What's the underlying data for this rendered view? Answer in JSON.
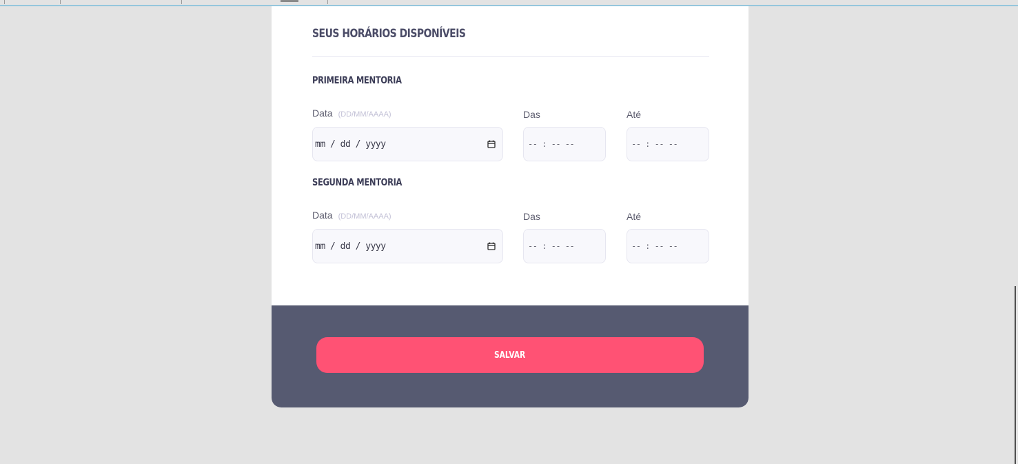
{
  "form": {
    "title": "SEUS HORÁRIOS DISPONÍVEIS",
    "sections": [
      {
        "title": "PRIMEIRA MENTORIA",
        "date_label": "Data",
        "date_hint": "(DD/MM/AAAA)",
        "date_value": "mm / dd / yyyy",
        "from_label": "Das",
        "from_value": "-- : --  --",
        "to_label": "Até",
        "to_value": "-- : --  --"
      },
      {
        "title": "SEGUNDA MENTORIA",
        "date_label": "Data",
        "date_hint": "(DD/MM/AAAA)",
        "date_value": "mm / dd / yyyy",
        "from_label": "Das",
        "from_value": "-- : --  --",
        "to_label": "Até",
        "to_value": "-- : --  --"
      }
    ],
    "save_label": "SALVAR"
  },
  "icons": {
    "calendar": "calendar-icon"
  },
  "colors": {
    "page_background": "#e3e3e3",
    "card": "#ffffff",
    "footer": "#565a71",
    "accent": "#ff5274",
    "heading": "#4b4c67"
  }
}
